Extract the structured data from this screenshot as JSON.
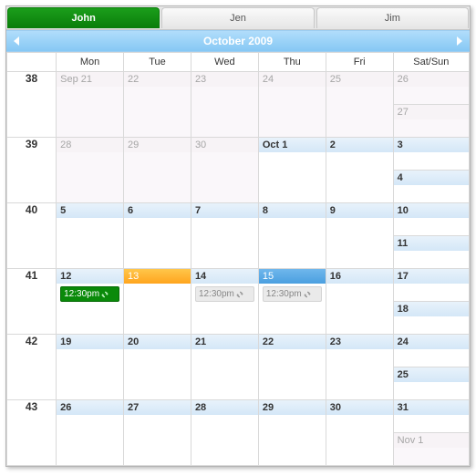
{
  "tabs": [
    {
      "label": "John",
      "active": true
    },
    {
      "label": "Jen",
      "active": false
    },
    {
      "label": "Jim",
      "active": false
    }
  ],
  "title": "October 2009",
  "dow": [
    "Mon",
    "Tue",
    "Wed",
    "Thu",
    "Fri",
    "Sat/Sun"
  ],
  "weeks": [
    {
      "wk": "38",
      "days": [
        {
          "label": "Sep 21",
          "state": "out"
        },
        {
          "label": "22",
          "state": "out"
        },
        {
          "label": "23",
          "state": "out"
        },
        {
          "label": "24",
          "state": "out"
        },
        {
          "label": "25",
          "state": "out"
        }
      ],
      "weekend": [
        {
          "label": "26",
          "state": "out"
        },
        {
          "label": "27",
          "state": "out"
        }
      ]
    },
    {
      "wk": "39",
      "days": [
        {
          "label": "28",
          "state": "out"
        },
        {
          "label": "29",
          "state": "out"
        },
        {
          "label": "30",
          "state": "out"
        },
        {
          "label": "Oct 1",
          "state": "in"
        },
        {
          "label": "2",
          "state": "in"
        }
      ],
      "weekend": [
        {
          "label": "3",
          "state": "in"
        },
        {
          "label": "4",
          "state": "in"
        }
      ]
    },
    {
      "wk": "40",
      "days": [
        {
          "label": "5",
          "state": "in"
        },
        {
          "label": "6",
          "state": "in"
        },
        {
          "label": "7",
          "state": "in"
        },
        {
          "label": "8",
          "state": "in"
        },
        {
          "label": "9",
          "state": "in"
        }
      ],
      "weekend": [
        {
          "label": "10",
          "state": "in"
        },
        {
          "label": "11",
          "state": "in"
        }
      ]
    },
    {
      "wk": "41",
      "days": [
        {
          "label": "12",
          "state": "in",
          "events": [
            {
              "time": "12:30pm",
              "style": "green",
              "recurring": true
            }
          ]
        },
        {
          "label": "13",
          "state": "today"
        },
        {
          "label": "14",
          "state": "in",
          "events": [
            {
              "time": "12:30pm",
              "style": "grey",
              "recurring": true
            }
          ]
        },
        {
          "label": "15",
          "state": "sel",
          "events": [
            {
              "time": "12:30pm",
              "style": "grey",
              "recurring": true
            }
          ]
        },
        {
          "label": "16",
          "state": "in"
        }
      ],
      "weekend": [
        {
          "label": "17",
          "state": "in"
        },
        {
          "label": "18",
          "state": "in"
        }
      ]
    },
    {
      "wk": "42",
      "days": [
        {
          "label": "19",
          "state": "in"
        },
        {
          "label": "20",
          "state": "in"
        },
        {
          "label": "21",
          "state": "in"
        },
        {
          "label": "22",
          "state": "in"
        },
        {
          "label": "23",
          "state": "in"
        }
      ],
      "weekend": [
        {
          "label": "24",
          "state": "in"
        },
        {
          "label": "25",
          "state": "in"
        }
      ]
    },
    {
      "wk": "43",
      "days": [
        {
          "label": "26",
          "state": "in"
        },
        {
          "label": "27",
          "state": "in"
        },
        {
          "label": "28",
          "state": "in"
        },
        {
          "label": "29",
          "state": "in"
        },
        {
          "label": "30",
          "state": "in"
        }
      ],
      "weekend": [
        {
          "label": "31",
          "state": "in"
        },
        {
          "label": "Nov 1",
          "state": "out"
        }
      ]
    }
  ]
}
